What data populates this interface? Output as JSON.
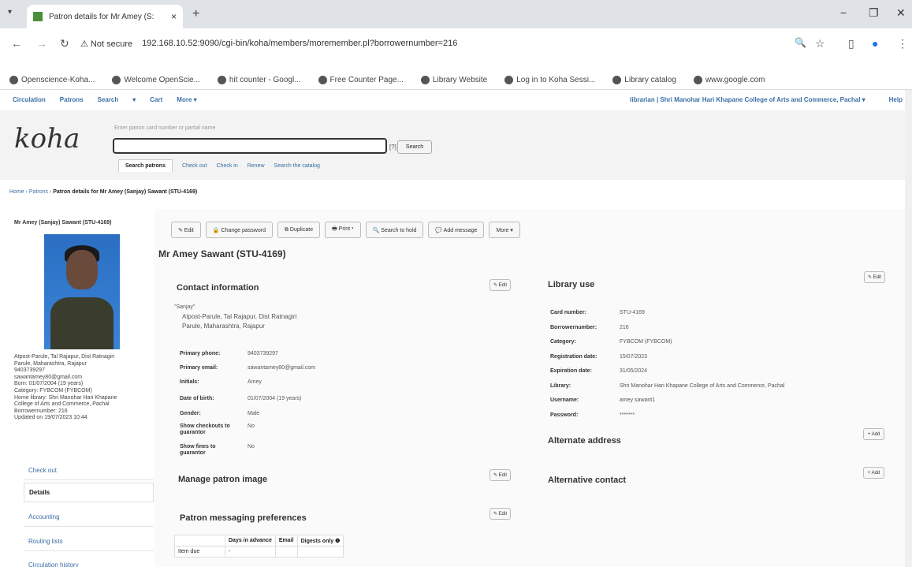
{
  "browser": {
    "tab_title": "Patron details for Mr Amey (S:",
    "tab_close": "×",
    "new_tab": "+",
    "not_secure": "Not secure",
    "url": "192.168.10.52:9090/cgi-bin/koha/members/moremember.pl?borrowernumber=216",
    "bookmarks": [
      "Openscience-Koha...",
      "Welcome OpenScie...",
      "hit counter - Googl...",
      "Free Counter Page...",
      "Library Website",
      "Log in to Koha Sessi...",
      "Library catalog",
      "www.google.com"
    ]
  },
  "koha": {
    "topnav": [
      "Circulation",
      "Patrons",
      "Search",
      "▾",
      "Cart",
      "More ▾"
    ],
    "topright": "librarian | Shri Manohar Hari Khapane College of Arts and Commerce, Pachal ▾",
    "help": "Help",
    "logo": "koha",
    "search_hint": "Enter patron card number or partial name",
    "search_q": "[?]",
    "search_button": "Search",
    "subtabs": [
      "Search patrons",
      "Check out",
      "Check in",
      "Renew",
      "Search the catalog"
    ],
    "breadcrumb_prefix": "Home › Patrons ›",
    "breadcrumb_current": "Patron details for Mr Amey (Sanjay) Sawant (STU-4169)"
  },
  "left": {
    "name": "Mr Amey (Sanjay) Sawant (STU-4169)",
    "info": [
      "Atpost-Parule, Tal Rajapur, Dist Ratnagiri",
      "Parule, Maharashtra, Rajapur",
      "9403739297",
      "sawantamey80@gmail.com",
      "Born: 01/07/2004 (19 years)",
      "Category: FYBCOM (FYBCOM)",
      "Home library: Shri Manohar Hari Khapane",
      "College of Arts and Commerce, Pachal",
      "Borrowernumber: 216",
      "Updated on 19/07/2023 10:44"
    ],
    "nav": [
      "Check out",
      "Details",
      "Accounting",
      "Routing lists",
      "Circulation history"
    ]
  },
  "toolbar": [
    "✎ Edit",
    "🔒 Change password",
    "⧉ Duplicate",
    "🖶 Print ▾",
    "🔍 Search to hold",
    "💬 Add message",
    "More ▾"
  ],
  "patron_name": "Mr Amey Sawant (STU-4169)",
  "contact": {
    "heading": "Contact information",
    "edit": "✎ Edit",
    "alias": "\"Sanjay\"",
    "address1": "Atpost-Parule, Tal Rajapur, Dist Ratnagiri",
    "address2": "Parule, Maharashtra, Rajapur",
    "rows": [
      {
        "label": "Primary phone:",
        "value": "9403739297"
      },
      {
        "label": "Primary email:",
        "value": "sawantamey80@gmail.com"
      },
      {
        "label": "Initials:",
        "value": "Amey"
      },
      {
        "label": "Date of birth:",
        "value": "01/07/2004 (19 years)"
      },
      {
        "label": "Gender:",
        "value": "Male"
      },
      {
        "label": "Show checkouts to guarantor",
        "value": "No"
      },
      {
        "label": "Show fines to guarantor",
        "value": "No"
      }
    ]
  },
  "manage_image": {
    "heading": "Manage patron image",
    "edit": "✎ Edit"
  },
  "messaging": {
    "heading": "Patron messaging preferences",
    "edit": "✎ Edit",
    "columns": [
      "",
      "Days in advance",
      "Email",
      "Digests only ❶"
    ],
    "rows": [
      [
        "Item due",
        "-",
        "",
        ""
      ]
    ]
  },
  "library_use": {
    "heading": "Library use",
    "edit": "✎ Edit",
    "rows": [
      {
        "label": "Card number:",
        "value": "STU-4169"
      },
      {
        "label": "Borrowernumber:",
        "value": "216"
      },
      {
        "label": "Category:",
        "value": "FYBCOM (FYBCOM)"
      },
      {
        "label": "Registration date:",
        "value": "15/07/2023"
      },
      {
        "label": "Expiration date:",
        "value": "31/05/2024"
      },
      {
        "label": "Library:",
        "value": "Shri Manohar Hari Khapane College of Arts and Commerce, Pachal"
      },
      {
        "label": "Username:",
        "value": "amey sawant1"
      },
      {
        "label": "Password:",
        "value": "*******"
      }
    ]
  },
  "alt_address": {
    "heading": "Alternate address",
    "add": "+ Add"
  },
  "alt_contact": {
    "heading": "Alternative contact",
    "add": "+ Add"
  }
}
